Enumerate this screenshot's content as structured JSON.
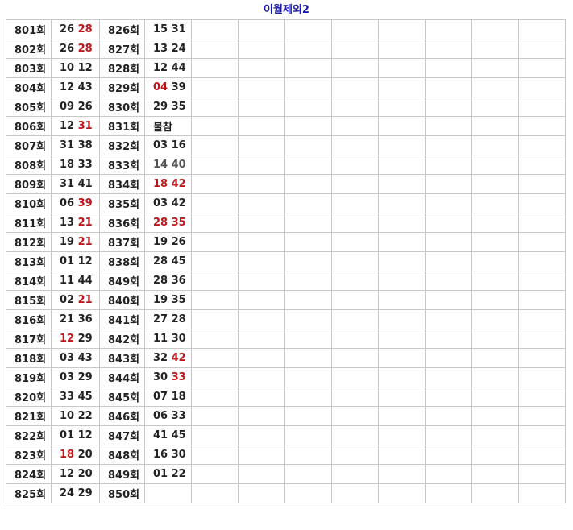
{
  "title": "이월제외2",
  "colors": {
    "highlight": "#c0151b",
    "muted": "#555555",
    "title": "#1a1aa6",
    "text": "#222222"
  },
  "rows": [
    {
      "r1": "801회",
      "a": [
        {
          "t": "26",
          "c": "n"
        },
        {
          "t": "28",
          "c": "r"
        }
      ],
      "r2": "826회",
      "b": [
        {
          "t": "15",
          "c": "n"
        },
        {
          "t": "31",
          "c": "n"
        }
      ]
    },
    {
      "r1": "802회",
      "a": [
        {
          "t": "26",
          "c": "n"
        },
        {
          "t": "28",
          "c": "r"
        }
      ],
      "r2": "827회",
      "b": [
        {
          "t": "13",
          "c": "n"
        },
        {
          "t": "24",
          "c": "n"
        }
      ]
    },
    {
      "r1": "803회",
      "a": [
        {
          "t": "10",
          "c": "n"
        },
        {
          "t": "12",
          "c": "n"
        }
      ],
      "r2": "828회",
      "b": [
        {
          "t": "12",
          "c": "n"
        },
        {
          "t": "44",
          "c": "n"
        }
      ]
    },
    {
      "r1": "804회",
      "a": [
        {
          "t": "12",
          "c": "n"
        },
        {
          "t": "43",
          "c": "n"
        }
      ],
      "r2": "829회",
      "b": [
        {
          "t": "04",
          "c": "r"
        },
        {
          "t": "39",
          "c": "n"
        }
      ]
    },
    {
      "r1": "805회",
      "a": [
        {
          "t": "09",
          "c": "n"
        },
        {
          "t": "26",
          "c": "n"
        }
      ],
      "r2": "830회",
      "b": [
        {
          "t": "29",
          "c": "n"
        },
        {
          "t": "35",
          "c": "n"
        }
      ]
    },
    {
      "r1": "806회",
      "a": [
        {
          "t": "12",
          "c": "n"
        },
        {
          "t": "31",
          "c": "r"
        }
      ],
      "r2": "831회",
      "b": [
        {
          "t": "불참",
          "c": "n"
        }
      ]
    },
    {
      "r1": "807회",
      "a": [
        {
          "t": "31",
          "c": "n"
        },
        {
          "t": "38",
          "c": "n"
        }
      ],
      "r2": "832회",
      "b": [
        {
          "t": "03",
          "c": "n"
        },
        {
          "t": "16",
          "c": "n"
        }
      ]
    },
    {
      "r1": "808회",
      "a": [
        {
          "t": "18",
          "c": "n"
        },
        {
          "t": "33",
          "c": "n"
        }
      ],
      "r2": "833회",
      "b": [
        {
          "t": "14",
          "c": "g"
        },
        {
          "t": "40",
          "c": "g"
        }
      ]
    },
    {
      "r1": "809회",
      "a": [
        {
          "t": "31",
          "c": "n"
        },
        {
          "t": "41",
          "c": "n"
        }
      ],
      "r2": "834회",
      "b": [
        {
          "t": "18",
          "c": "r"
        },
        {
          "t": "42",
          "c": "r"
        }
      ]
    },
    {
      "r1": "810회",
      "a": [
        {
          "t": "06",
          "c": "n"
        },
        {
          "t": "39",
          "c": "r"
        }
      ],
      "r2": "835회",
      "b": [
        {
          "t": "03",
          "c": "n"
        },
        {
          "t": "42",
          "c": "n"
        }
      ]
    },
    {
      "r1": "811회",
      "a": [
        {
          "t": "13",
          "c": "n"
        },
        {
          "t": "21",
          "c": "r"
        }
      ],
      "r2": "836회",
      "b": [
        {
          "t": "28",
          "c": "r"
        },
        {
          "t": "35",
          "c": "r"
        }
      ]
    },
    {
      "r1": "812회",
      "a": [
        {
          "t": "19",
          "c": "n"
        },
        {
          "t": "21",
          "c": "r"
        }
      ],
      "r2": "837회",
      "b": [
        {
          "t": "19",
          "c": "n"
        },
        {
          "t": "26",
          "c": "n"
        }
      ]
    },
    {
      "r1": "813회",
      "a": [
        {
          "t": "01",
          "c": "n"
        },
        {
          "t": "12",
          "c": "n"
        }
      ],
      "r2": "838회",
      "b": [
        {
          "t": "28",
          "c": "n"
        },
        {
          "t": "45",
          "c": "n"
        }
      ]
    },
    {
      "r1": "814회",
      "a": [
        {
          "t": "11",
          "c": "n"
        },
        {
          "t": "44",
          "c": "n"
        }
      ],
      "r2": "849회",
      "b": [
        {
          "t": "28",
          "c": "n"
        },
        {
          "t": "36",
          "c": "n"
        }
      ]
    },
    {
      "r1": "815회",
      "a": [
        {
          "t": "02",
          "c": "n"
        },
        {
          "t": "21",
          "c": "r"
        }
      ],
      "r2": "840회",
      "b": [
        {
          "t": "19",
          "c": "n"
        },
        {
          "t": "35",
          "c": "n"
        }
      ]
    },
    {
      "r1": "816회",
      "a": [
        {
          "t": "21",
          "c": "n"
        },
        {
          "t": "36",
          "c": "n"
        }
      ],
      "r2": "841회",
      "b": [
        {
          "t": "27",
          "c": "n"
        },
        {
          "t": "28",
          "c": "n"
        }
      ]
    },
    {
      "r1": "817회",
      "a": [
        {
          "t": "12",
          "c": "r"
        },
        {
          "t": "29",
          "c": "n"
        }
      ],
      "r2": "842회",
      "b": [
        {
          "t": "11",
          "c": "n"
        },
        {
          "t": "30",
          "c": "n"
        }
      ]
    },
    {
      "r1": "818회",
      "a": [
        {
          "t": "03",
          "c": "n"
        },
        {
          "t": "43",
          "c": "n"
        }
      ],
      "r2": "843회",
      "b": [
        {
          "t": "32",
          "c": "n"
        },
        {
          "t": "42",
          "c": "r"
        }
      ]
    },
    {
      "r1": "819회",
      "a": [
        {
          "t": "03",
          "c": "n"
        },
        {
          "t": "29",
          "c": "n"
        }
      ],
      "r2": "844회",
      "b": [
        {
          "t": "30",
          "c": "n"
        },
        {
          "t": "33",
          "c": "r"
        }
      ]
    },
    {
      "r1": "820회",
      "a": [
        {
          "t": "33",
          "c": "n"
        },
        {
          "t": "45",
          "c": "n"
        }
      ],
      "r2": "845회",
      "b": [
        {
          "t": "07",
          "c": "n"
        },
        {
          "t": "18",
          "c": "n"
        }
      ]
    },
    {
      "r1": "821회",
      "a": [
        {
          "t": "10",
          "c": "n"
        },
        {
          "t": "22",
          "c": "n"
        }
      ],
      "r2": "846회",
      "b": [
        {
          "t": "06",
          "c": "n"
        },
        {
          "t": "33",
          "c": "n"
        }
      ]
    },
    {
      "r1": "822회",
      "a": [
        {
          "t": "01",
          "c": "n"
        },
        {
          "t": "12",
          "c": "n"
        }
      ],
      "r2": "847회",
      "b": [
        {
          "t": "41",
          "c": "n"
        },
        {
          "t": "45",
          "c": "n"
        }
      ]
    },
    {
      "r1": "823회",
      "a": [
        {
          "t": "18",
          "c": "r"
        },
        {
          "t": "20",
          "c": "n"
        }
      ],
      "r2": "848회",
      "b": [
        {
          "t": "16",
          "c": "n"
        },
        {
          "t": "30",
          "c": "n"
        }
      ]
    },
    {
      "r1": "824회",
      "a": [
        {
          "t": "12",
          "c": "n"
        },
        {
          "t": "20",
          "c": "n"
        }
      ],
      "r2": "849회",
      "b": [
        {
          "t": "01",
          "c": "n"
        },
        {
          "t": "22",
          "c": "n"
        }
      ]
    },
    {
      "r1": "825회",
      "a": [
        {
          "t": "24",
          "c": "n"
        },
        {
          "t": "29",
          "c": "n"
        }
      ],
      "r2": "850회",
      "b": []
    }
  ]
}
